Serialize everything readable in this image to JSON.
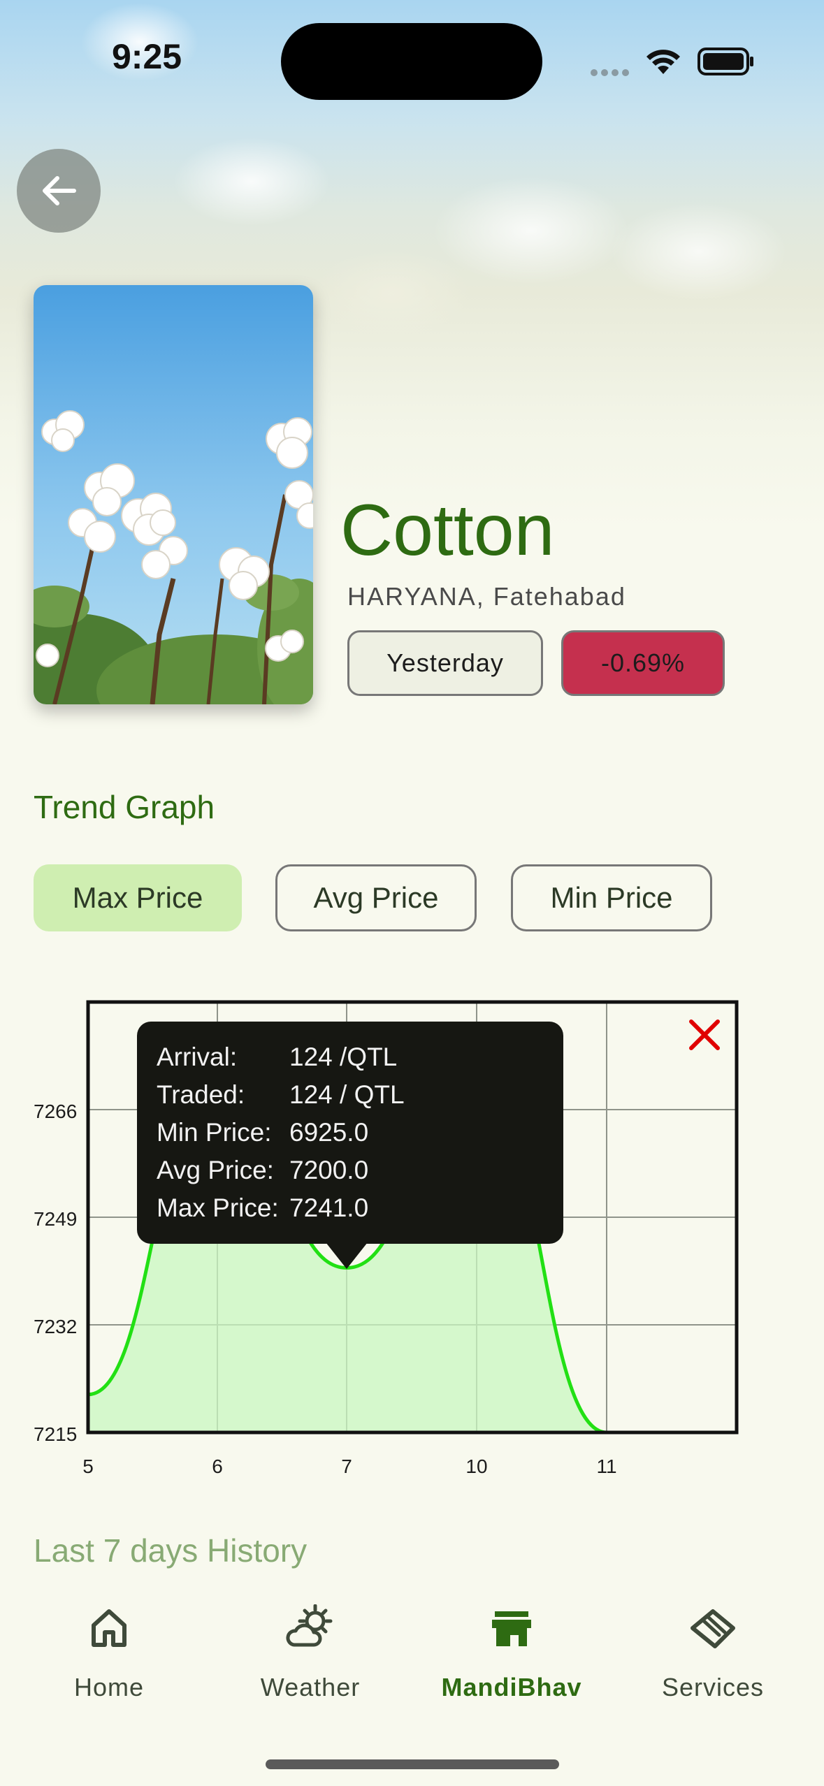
{
  "status_bar": {
    "time": "9:25"
  },
  "crop": {
    "name": "Cotton",
    "location": "HARYANA, Fatehabad",
    "date_label": "Yesterday",
    "change": "-0.69%",
    "change_color": "#c5304e"
  },
  "trend": {
    "title": "Trend Graph",
    "tabs": [
      "Max Price",
      "Avg Price",
      "Min Price"
    ],
    "selected_tab": "Max Price"
  },
  "tooltip": {
    "rows": [
      {
        "k": "Arrival:",
        "v": "124 /QTL"
      },
      {
        "k": "Traded:",
        "v": "124 / QTL"
      },
      {
        "k": "Min Price:",
        "v": "6925.0"
      },
      {
        "k": "Avg Price:",
        "v": "7200.0"
      },
      {
        "k": "Max Price:",
        "v": "7241.0"
      }
    ]
  },
  "chart_data": {
    "type": "line",
    "x": [
      "5",
      "6",
      "7",
      "10",
      "11"
    ],
    "series": [
      {
        "values": [
          7221,
          7270,
          7241,
          7270,
          7215
        ]
      }
    ],
    "y_ticks": [
      "7215",
      "7232",
      "7249",
      "7266"
    ],
    "ylim": [
      7215,
      7283
    ],
    "grid": true,
    "line_color": "#22e014",
    "fill_color": "#c9f7c0"
  },
  "history": {
    "title": "Last 7 days History"
  },
  "nav": {
    "items": [
      {
        "label": "Home",
        "icon": "home-icon"
      },
      {
        "label": "Weather",
        "icon": "weather-icon"
      },
      {
        "label": "MandiBhav",
        "icon": "store-icon"
      },
      {
        "label": "Services",
        "icon": "handshake-icon"
      }
    ],
    "active": "MandiBhav",
    "active_color": "#2e6b12"
  }
}
